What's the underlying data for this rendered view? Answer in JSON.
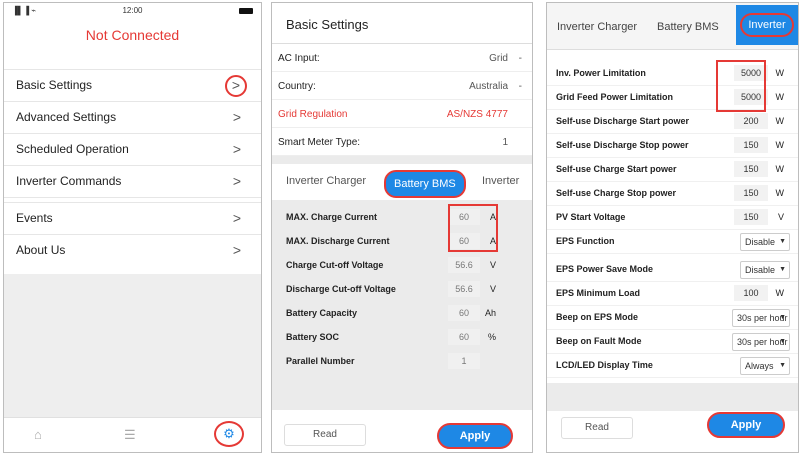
{
  "screen1": {
    "status": {
      "signal": "▐▌▐ ⌁",
      "time": "12:00"
    },
    "connection": "Not Connected",
    "menu": [
      {
        "label": "Basic Settings"
      },
      {
        "label": "Advanced Settings"
      },
      {
        "label": "Scheduled Operation"
      },
      {
        "label": "Inverter Commands"
      },
      {
        "label": "Events"
      },
      {
        "label": "About Us"
      }
    ],
    "chevron": ">",
    "tabbar": {
      "home": "⌂",
      "sliders": "☰",
      "settings": "⚙"
    }
  },
  "screen2": {
    "title": "Basic Settings",
    "fields": [
      {
        "label": "AC Input:",
        "value": "Grid",
        "dropdown": "-"
      },
      {
        "label": "Country:",
        "value": "Australia",
        "dropdown": "-"
      },
      {
        "label": "Grid Regulation",
        "value": "AS/NZS 4777",
        "dropdown": ""
      },
      {
        "label": "Smart Meter Type:",
        "value": "1",
        "dropdown": ""
      }
    ],
    "tabs": [
      "Inverter Charger",
      "Battery BMS",
      "Inverter"
    ],
    "bms": [
      {
        "label": "MAX. Charge Current",
        "value": "60",
        "unit": "A"
      },
      {
        "label": "MAX. Discharge Current",
        "value": "60",
        "unit": "A"
      },
      {
        "label": "Charge Cut-off Voltage",
        "value": "56.6",
        "unit": "V"
      },
      {
        "label": "Discharge Cut-off Voltage",
        "value": "56.6",
        "unit": "V"
      },
      {
        "label": "Battery Capacity",
        "value": "60",
        "unit": "Ah"
      },
      {
        "label": "Battery SOC",
        "value": "60",
        "unit": "%"
      },
      {
        "label": "Parallel Number",
        "value": "1",
        "unit": ""
      }
    ],
    "buttons": {
      "read": "Read",
      "apply": "Apply"
    },
    "tabbar": {
      "home": "⌂",
      "sliders": "☰",
      "settings": "⚙"
    }
  },
  "screen3": {
    "tabs": [
      "Inverter Charger",
      "Battery BMS",
      "Inverter"
    ],
    "rows": [
      {
        "label": "Inv. Power Limitation",
        "value": "5000",
        "unit": "W"
      },
      {
        "label": "Grid Feed Power Limitation",
        "value": "5000",
        "unit": "W"
      },
      {
        "label": "Self-use Discharge Start power",
        "value": "200",
        "unit": "W"
      },
      {
        "label": "Self-use Discharge Stop power",
        "value": "150",
        "unit": "W"
      },
      {
        "label": "Self-use Charge Start power",
        "value": "150",
        "unit": "W"
      },
      {
        "label": "Self-use Charge Stop power",
        "value": "150",
        "unit": "W"
      },
      {
        "label": "PV Start Voltage",
        "value": "150",
        "unit": "V"
      },
      {
        "label": "EPS Function",
        "select": "Disable"
      },
      {
        "label": "EPS Power Save Mode",
        "select": "Disable"
      },
      {
        "label": "EPS Minimum Load",
        "value": "100",
        "unit": "W"
      },
      {
        "label": "Beep on EPS Mode",
        "select": "30s per hour"
      },
      {
        "label": "Beep on Fault Mode",
        "select": "30s per hour"
      },
      {
        "label": "LCD/LED Display Time",
        "select": "Always"
      }
    ],
    "buttons": {
      "read": "Read",
      "apply": "Apply"
    },
    "tabbar": {
      "home": "⌂",
      "sliders": "☰",
      "settings": "⚙"
    }
  }
}
